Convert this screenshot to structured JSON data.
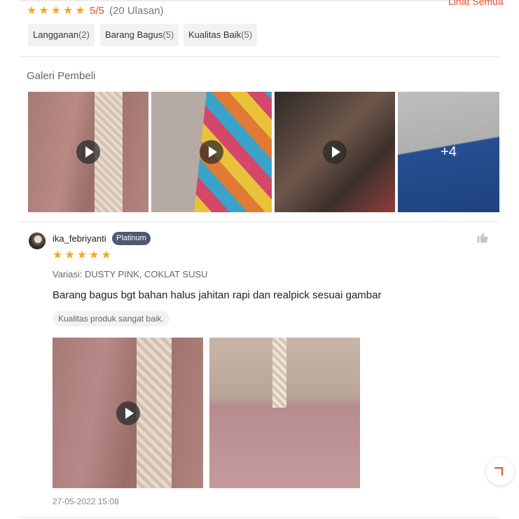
{
  "summary": {
    "star_count": 5,
    "rating": "5/5",
    "review_count": "(20 Ulasan)",
    "see_all": "Lihat Semua"
  },
  "filters": [
    {
      "label": "Langganan",
      "count": "(2)"
    },
    {
      "label": "Barang Bagus",
      "count": "(5)"
    },
    {
      "label": "Kualitas Baik",
      "count": "(5)"
    }
  ],
  "gallery": {
    "title": "Galeri Pembeli",
    "more_label": "+4"
  },
  "review": {
    "username": "ika_febriyanti",
    "badge": "Platinum",
    "star_count": 5,
    "variation": "Variasi: DUSTY PINK, COKLAT SUSU",
    "text": "Barang bagus bgt bahan halus jahitan rapi dan realpick sesuai gambar",
    "tag": "Kualitas produk sangat baik.",
    "date": "27-05-2022 15:08"
  },
  "colors": {
    "accent": "#ee4d2d",
    "star": "#f5a623",
    "badge_bg": "#4d5970"
  }
}
